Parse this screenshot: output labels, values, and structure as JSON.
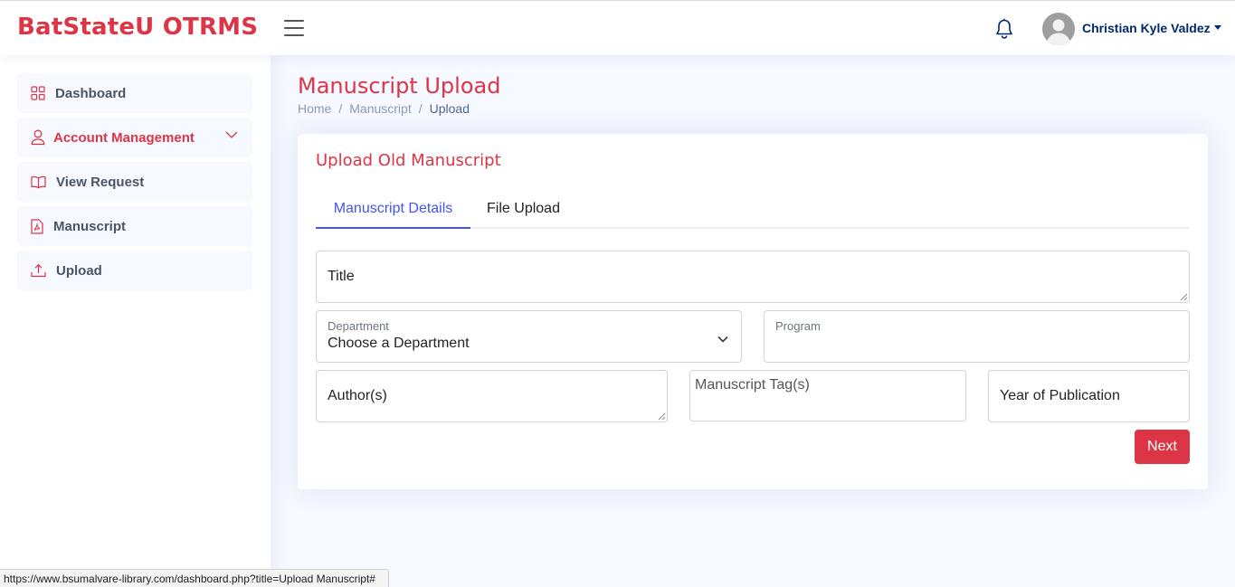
{
  "header": {
    "logo": "BatStateU OTRMS",
    "user_name": "Christian Kyle Valdez"
  },
  "sidebar": {
    "items": [
      {
        "label": "Dashboard",
        "icon": "grid-icon"
      },
      {
        "label": "Account Management",
        "icon": "person-icon",
        "active": true
      },
      {
        "label": "View Request",
        "icon": "book-icon"
      },
      {
        "label": "Manuscript",
        "icon": "file-pdf-icon"
      },
      {
        "label": "Upload",
        "icon": "upload-icon"
      }
    ]
  },
  "page": {
    "title": "Manuscript Upload",
    "breadcrumb": [
      "Home",
      "Manuscript",
      "Upload"
    ]
  },
  "card": {
    "title": "Upload Old Manuscript",
    "tabs": [
      "Manuscript Details",
      "File Upload"
    ],
    "active_tab": "Manuscript Details",
    "fields": {
      "title_placeholder": "Title",
      "department_label": "Department",
      "department_value": "Choose a Department",
      "program_label": "Program",
      "authors_placeholder": "Author(s)",
      "tags_placeholder": "Manuscript Tag(s)",
      "year_placeholder": "Year of Publication"
    },
    "next_label": "Next"
  },
  "status_bar": {
    "url": "https://www.bsumalvare-library.com/dashboard.php?title=Upload Manuscript#"
  },
  "colors": {
    "brand": "#dc3545",
    "accent": "#4154f1",
    "nav_text": "#012970"
  }
}
